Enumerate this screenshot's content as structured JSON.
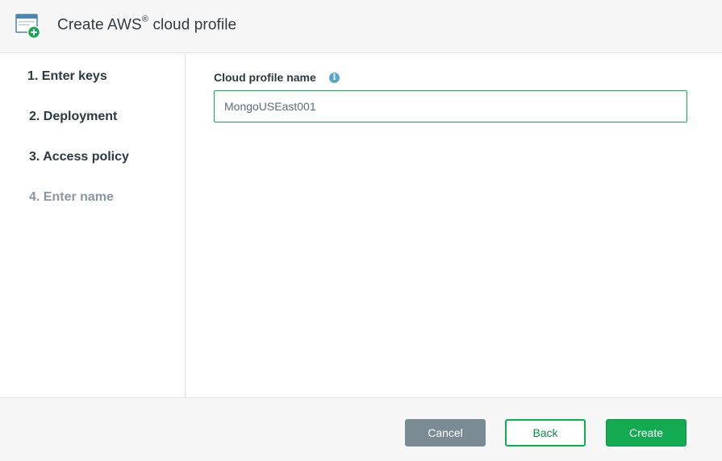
{
  "dialog": {
    "title_prefix": "Create AWS",
    "title_reg_mark": "®",
    "title_suffix": " cloud profile",
    "icon": "window-add-icon"
  },
  "steps": [
    {
      "label": "1. Enter keys",
      "state": "completed"
    },
    {
      "label": "2. Deployment",
      "state": "completed"
    },
    {
      "label": "3. Access policy",
      "state": "completed"
    },
    {
      "label": "4. Enter name",
      "state": "current"
    }
  ],
  "form": {
    "field_label": "Cloud profile name",
    "info_icon": "info-icon",
    "info_glyph": "i",
    "name_value": "MongoUSEast001"
  },
  "footer": {
    "cancel_label": "Cancel",
    "back_label": "Back",
    "create_label": "Create"
  },
  "colors": {
    "accent_green": "#13aa52",
    "cancel_gray": "#7b8b94",
    "inactive_step": "#8b979f",
    "info_blue": "#5aa8c8"
  }
}
